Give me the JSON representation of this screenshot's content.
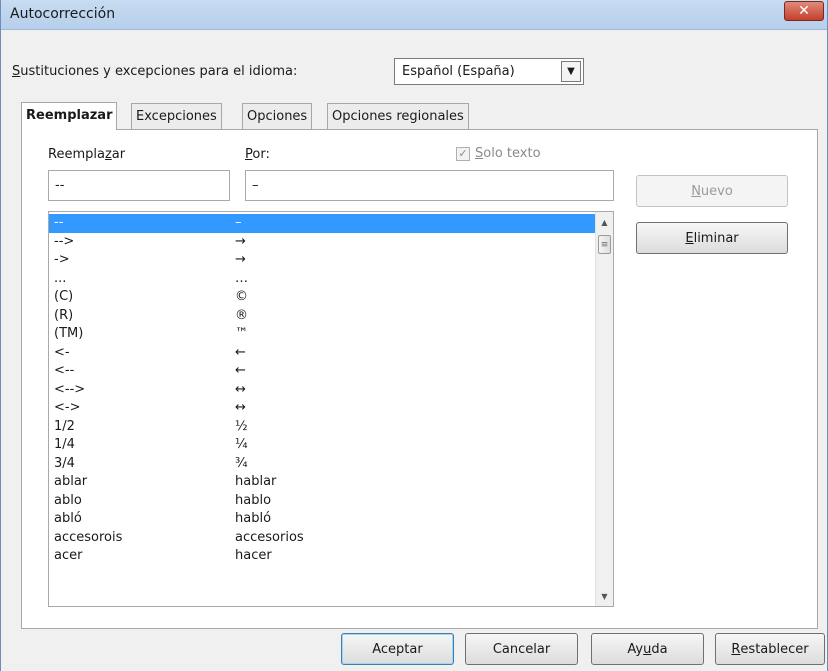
{
  "window": {
    "title": "Autocorrección",
    "close_glyph": "✕"
  },
  "language": {
    "label_pre": "",
    "label_mnemonic": "S",
    "label_post": "ustituciones y excepciones para el idioma:",
    "selected": "Español (España)",
    "arrow_glyph": "▼"
  },
  "tabs": [
    {
      "label": "Reemplazar",
      "active": true
    },
    {
      "label": "Excepciones",
      "active": false
    },
    {
      "label": "Opciones",
      "active": false
    },
    {
      "label": "Opciones regionales",
      "active": false
    }
  ],
  "replace": {
    "label_pre": "Reempla",
    "label_mnemonic": "z",
    "label_post": "ar",
    "value": "--"
  },
  "with": {
    "label_pre": "",
    "label_mnemonic": "P",
    "label_post": "or:",
    "value": "–"
  },
  "text_only": {
    "checked": true,
    "check_glyph": "✓",
    "label_pre": "",
    "label_mnemonic": "S",
    "label_post": "olo texto"
  },
  "buttons": {
    "new": {
      "pre": "",
      "mnemonic": "N",
      "post": "uevo",
      "enabled": false
    },
    "delete": {
      "pre": "",
      "mnemonic": "E",
      "post": "liminar",
      "enabled": true
    },
    "ok": "Aceptar",
    "cancel": "Cancelar",
    "help": {
      "pre": "Ay",
      "mnemonic": "u",
      "post": "da"
    },
    "reset": {
      "pre": "",
      "mnemonic": "R",
      "post": "establecer"
    }
  },
  "entries": [
    {
      "from": "--",
      "to": "–"
    },
    {
      "from": "-->",
      "to": "→"
    },
    {
      "from": "->",
      "to": "→"
    },
    {
      "from": "...",
      "to": "…"
    },
    {
      "from": "(C)",
      "to": "©"
    },
    {
      "from": "(R)",
      "to": "®"
    },
    {
      "from": "(TM)",
      "to": "™"
    },
    {
      "from": "<-",
      "to": "←"
    },
    {
      "from": "<--",
      "to": "←"
    },
    {
      "from": "<-->",
      "to": "↔"
    },
    {
      "from": "<->",
      "to": "↔"
    },
    {
      "from": "1/2",
      "to": "½"
    },
    {
      "from": "1/4",
      "to": "¼"
    },
    {
      "from": "3/4",
      "to": "¾"
    },
    {
      "from": "ablar",
      "to": "hablar"
    },
    {
      "from": "ablo",
      "to": "hablo"
    },
    {
      "from": "abló",
      "to": "habló"
    },
    {
      "from": "accesorois",
      "to": "accesorios"
    },
    {
      "from": "acer",
      "to": "hacer"
    }
  ],
  "selected_index": 0,
  "scrollbar": {
    "up_glyph": "▲",
    "down_glyph": "▼",
    "grip_glyph": "≡"
  }
}
